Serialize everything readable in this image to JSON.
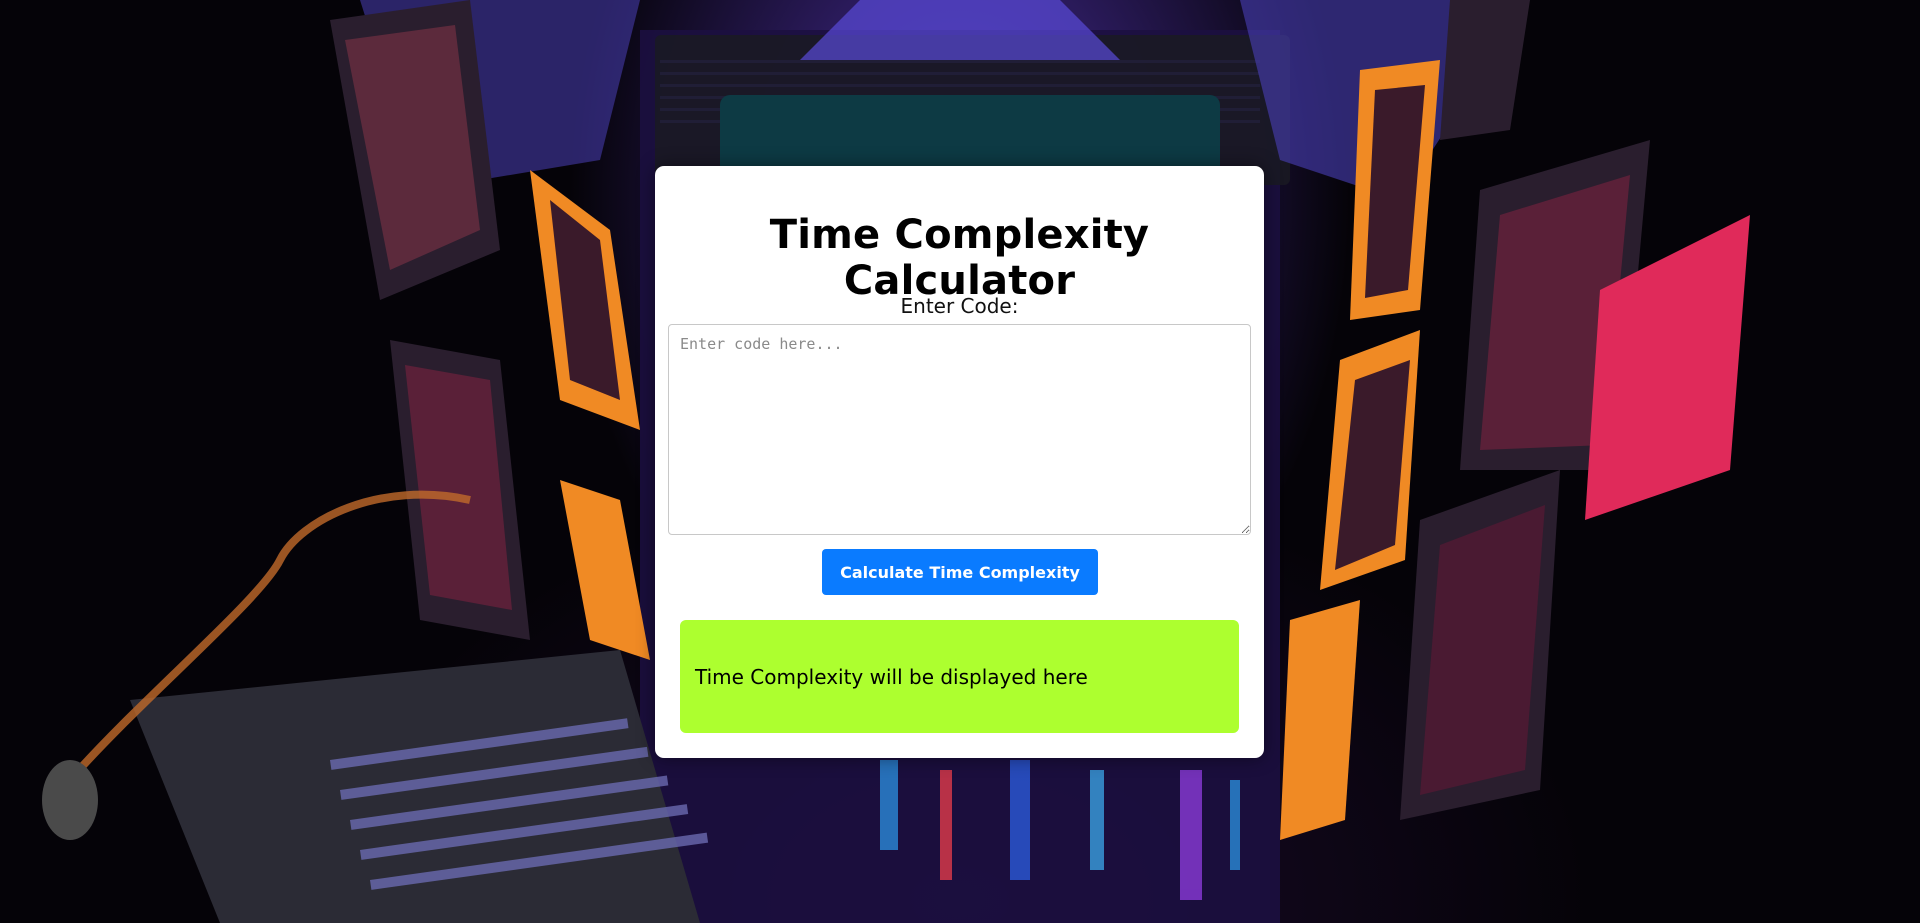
{
  "app": {
    "title": "Time Complexity Calculator"
  },
  "form": {
    "code_label": "Enter Code:",
    "code_value": "",
    "code_placeholder": "Enter code here...",
    "calculate_label": "Calculate Time Complexity"
  },
  "result": {
    "text": "Time Complexity will be displayed here"
  },
  "colors": {
    "button": "#0a7bff",
    "result_background": "#adff2f",
    "card": "#ffffff"
  }
}
